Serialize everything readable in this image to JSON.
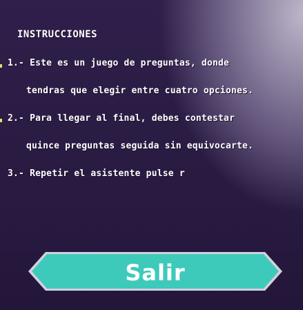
{
  "instructions": {
    "title": "INSTRUCCIONES",
    "items": [
      {
        "line1": "1.- Este es un juego de preguntas, donde",
        "line2": "tendras que elegir entre cuatro opciones."
      },
      {
        "line1": "2.- Para llegar al final, debes contestar",
        "line2": "quince preguntas seguida sin equivocarte."
      },
      {
        "line1": "3.- Repetir el asistente pulse r",
        "line2": ""
      }
    ]
  },
  "salir_button": {
    "label": "Salir",
    "fill_color": "#3ecabb",
    "border_color": "#d4d0de"
  }
}
